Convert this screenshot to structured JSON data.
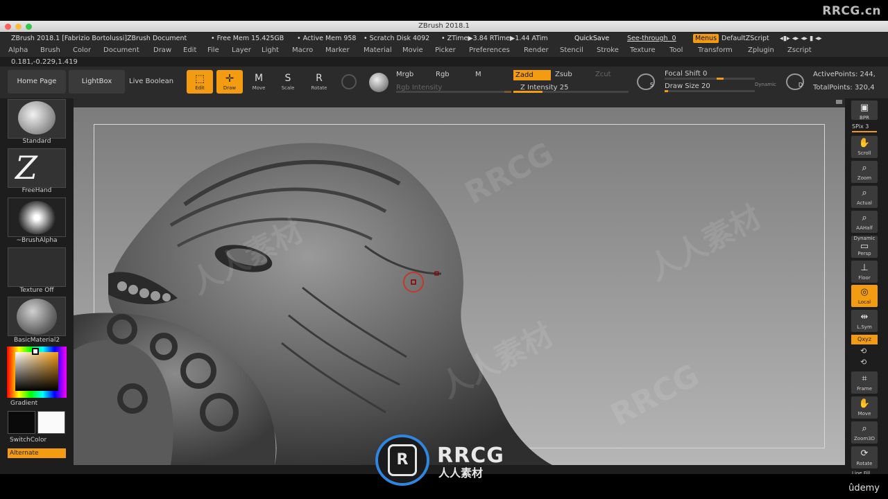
{
  "window": {
    "title": "ZBrush 2018.1"
  },
  "watermark": {
    "top_right": "RRCG.cn",
    "logo_main": "RRCG",
    "logo_sub": "人人素材",
    "repeat_text": "RRCG",
    "repeat_cn": "人人素材"
  },
  "status": {
    "app_doc": "ZBrush 2018.1 [Fabrizio Bortolussi]ZBrush Document",
    "free_mem": "• Free Mem 15.425GB",
    "active_mem": "• Active Mem 958",
    "scratch": "• Scratch Disk 4092",
    "ztime": "• ZTime▶3.84 RTime▶1.44 ATim",
    "quicksave": "QuickSave",
    "see_through": "See-through",
    "see_through_value": "0",
    "menus": "Menus",
    "default_zscript": "DefaultZScript"
  },
  "menu": [
    "Alpha",
    "Brush",
    "Color",
    "Document",
    "Draw",
    "Edit",
    "File",
    "Layer",
    "Light",
    "Macro",
    "Marker",
    "Material",
    "Movie",
    "Picker",
    "Preferences",
    "Render",
    "Stencil",
    "Stroke",
    "Texture",
    "Tool",
    "Transform",
    "Zplugin",
    "Zscript"
  ],
  "coords": "0.181,-0.229,1.419",
  "toolbar": {
    "home_page": "Home Page",
    "lightbox": "LightBox",
    "live_boolean": "Live Boolean",
    "edit": "Edit",
    "draw": "Draw",
    "move": "Move",
    "scale": "Scale",
    "rotate": "Rotate",
    "mrgb": "Mrgb",
    "rgb": "Rgb",
    "m": "M",
    "rgb_intensity": "Rgb Intensity",
    "zadd": "Zadd",
    "zsub": "Zsub",
    "zcut": "Zcut",
    "z_intensity": "Z Intensity 25",
    "focal_shift": "Focal Shift 0",
    "draw_size": "Draw Size 20",
    "dynamic": "Dynamic",
    "active_points": "ActivePoints: 244,",
    "total_points": "TotalPoints: 320,4"
  },
  "sliders": {
    "z_intensity_value": 25,
    "focal_shift_value": 0,
    "draw_size_value": 20
  },
  "left_shelf": {
    "brush": "Standard",
    "stroke": "FreeHand",
    "alpha": "~BrushAlpha",
    "texture": "Texture Off",
    "material": "BasicMaterial2",
    "gradient": "Gradient",
    "switch_color": "SwitchColor",
    "alternate": "Alternate"
  },
  "right_shelf": {
    "bpr": "BPR",
    "spix": "SPix 3",
    "scroll": "Scroll",
    "zoom": "Zoom",
    "actual": "Actual",
    "aahalf": "AAHalf",
    "persp_top": "Dynamic",
    "persp": "Persp",
    "floor": "Floor",
    "local": "Local",
    "lsym": "L.Sym",
    "xyz": "Qxyz",
    "frame": "Frame",
    "move": "Move",
    "zoom3d": "Zoom3D",
    "rotate": "Rotate",
    "line_fill": "Line Fill"
  },
  "footer": {
    "udemy": "ûdemy"
  },
  "colors": {
    "accent": "#f39c12",
    "panel": "#2b2b2b",
    "canvas_top": "#7c7c7c",
    "canvas_bottom": "#b6b6b6"
  }
}
